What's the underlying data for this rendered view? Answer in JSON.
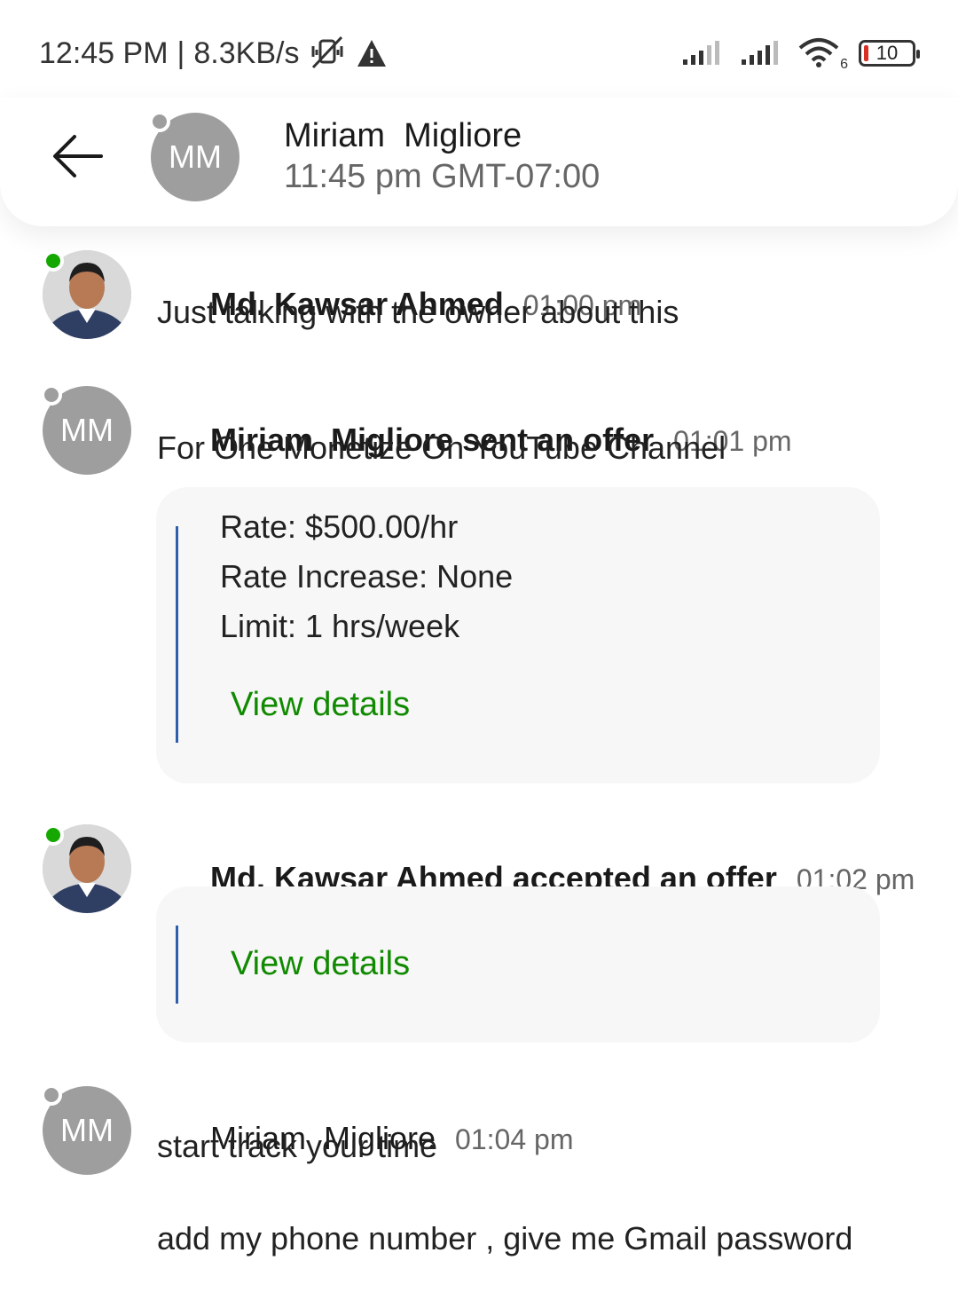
{
  "status_bar": {
    "time": "12:45 PM",
    "separator": "|",
    "speed": "8.3KB/s",
    "icons": [
      "mute-vibrate-icon",
      "alert-icon",
      "signal-icon",
      "signal-icon",
      "wifi-icon"
    ],
    "wifi_label": "6",
    "battery": "10"
  },
  "header": {
    "back_icon": "arrow-left-icon",
    "avatar_initials": "MM",
    "name": "Miriam  Migliore",
    "local_time": "11:45 pm GMT-07:00"
  },
  "messages": [
    {
      "sender": "Md. Kawsar Ahmed",
      "action": "",
      "time": "01:00 pm",
      "text": "Just talking with the owner about this"
    },
    {
      "sender": "Miriam  Migliore",
      "action": " sent an offer",
      "time": "01:01 pm",
      "avatar_initials": "MM",
      "text": "For One Monetize On YouTube Channel",
      "offer": {
        "rate": "Rate: $500.00/hr",
        "rate_increase": "Rate Increase: None",
        "limit": "Limit: 1 hrs/week",
        "link": "View details"
      }
    },
    {
      "sender": "Md. Kawsar Ahmed",
      "action": " accepted an offer",
      "time": "01:02 pm",
      "offer": {
        "link": "View details"
      }
    },
    {
      "sender": "Miriam  Migliore",
      "action": "",
      "time": "01:04 pm",
      "avatar_initials": "MM",
      "text": "start track your time",
      "text2": "add my phone number , give me Gmail password"
    }
  ],
  "colors": {
    "online": "#14a800",
    "offline": "#9e9e9e",
    "link": "#108a00",
    "card_bar": "#2d5fad",
    "battery_low": "#d93025"
  }
}
